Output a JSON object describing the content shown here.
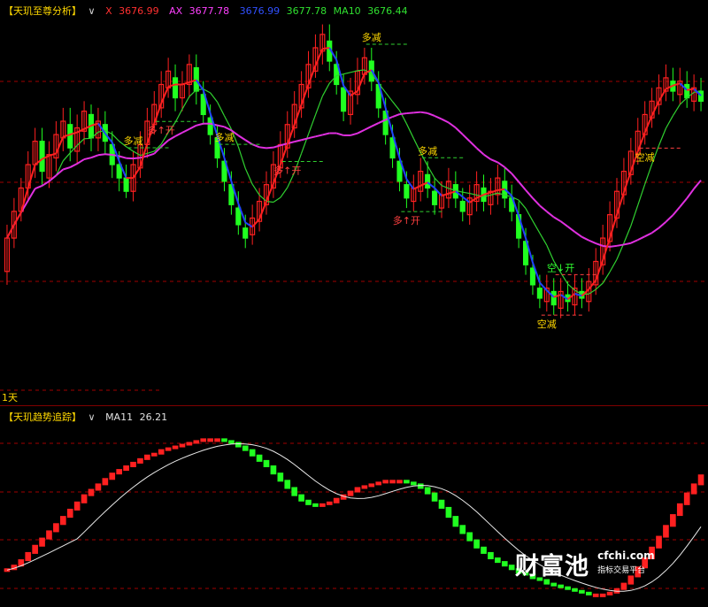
{
  "main_header": {
    "title": "【天玑至尊分析】",
    "chevron": "∨",
    "x": {
      "label": "X",
      "value": "3676.99",
      "color": "#ff3030"
    },
    "ax": {
      "label": "AX",
      "value": "3677.78",
      "color": "#ff40ff"
    },
    "v3": {
      "value": "3676.99",
      "color": "#3050ff"
    },
    "v4": {
      "value": "3677.78",
      "color": "#30e030"
    },
    "ma10": {
      "label": "MA10",
      "value": "3676.44",
      "color": "#30e030"
    }
  },
  "sub_header": {
    "title": "【天玑趋势追踪】",
    "chevron": "∨",
    "ma": {
      "label": "MA11",
      "value": "26.21",
      "color": "#e0e0e0"
    }
  },
  "period_label": "1天",
  "watermark": {
    "cn": "财富池",
    "domain": "cfchi.com",
    "sub": "指标交易平台"
  },
  "colors": {
    "up": "#ff2020",
    "down": "#20ff20",
    "fast_up": "#ff2020",
    "fast_down": "#2040ff",
    "slow": "#30d030",
    "long": "#e030e0",
    "signal": "#ffd800",
    "grid": "#a00000"
  },
  "chart_data": [
    {
      "type": "candlestick",
      "title": "【天玑至尊分析】",
      "ylim": [
        0,
        100
      ],
      "candles": [
        [
          30,
          40,
          26,
          44
        ],
        [
          40,
          48,
          37,
          52
        ],
        [
          48,
          55,
          45,
          58
        ],
        [
          55,
          62,
          51,
          66
        ],
        [
          62,
          69,
          58,
          73
        ],
        [
          69,
          60,
          56,
          73
        ],
        [
          58,
          65,
          55,
          69
        ],
        [
          64,
          71,
          60,
          75
        ],
        [
          70,
          75,
          66,
          79
        ],
        [
          74,
          67,
          63,
          79
        ],
        [
          66,
          73,
          62,
          77
        ],
        [
          72,
          78,
          68,
          81
        ],
        [
          77,
          70,
          66,
          80
        ],
        [
          70,
          75,
          66,
          79
        ],
        [
          74,
          69,
          65,
          78
        ],
        [
          68,
          62,
          58,
          72
        ],
        [
          62,
          58,
          54,
          66
        ],
        [
          58,
          54,
          52,
          62
        ],
        [
          54,
          62,
          51,
          66
        ],
        [
          61,
          68,
          58,
          72
        ],
        [
          68,
          75,
          64,
          79
        ],
        [
          74,
          80,
          71,
          84
        ],
        [
          79,
          86,
          76,
          90
        ],
        [
          85,
          90,
          82,
          94
        ],
        [
          88,
          82,
          78,
          92
        ],
        [
          82,
          86,
          78,
          90
        ],
        [
          86,
          92,
          82,
          95
        ],
        [
          91,
          84,
          80,
          95
        ],
        [
          83,
          77,
          74,
          87
        ],
        [
          76,
          71,
          68,
          80
        ],
        [
          70,
          64,
          61,
          74
        ],
        [
          63,
          57,
          54,
          67
        ],
        [
          56,
          50,
          47,
          60
        ],
        [
          49,
          44,
          41,
          54
        ],
        [
          43,
          40,
          37,
          47
        ],
        [
          41,
          46,
          38,
          50
        ],
        [
          45,
          51,
          42,
          55
        ],
        [
          50,
          56,
          47,
          60
        ],
        [
          55,
          62,
          52,
          66
        ],
        [
          61,
          68,
          58,
          72
        ],
        [
          67,
          74,
          64,
          78
        ],
        [
          73,
          80,
          70,
          84
        ],
        [
          79,
          86,
          76,
          90
        ],
        [
          85,
          92,
          82,
          96
        ],
        [
          90,
          97,
          88,
          101
        ],
        [
          96,
          101,
          92,
          104
        ],
        [
          99,
          93,
          90,
          104
        ],
        [
          92,
          86,
          83,
          96
        ],
        [
          85,
          78,
          75,
          89
        ],
        [
          77,
          84,
          74,
          88
        ],
        [
          83,
          90,
          80,
          94
        ],
        [
          89,
          94,
          86,
          97
        ],
        [
          93,
          87,
          84,
          97
        ],
        [
          86,
          79,
          76,
          90
        ],
        [
          78,
          71,
          68,
          82
        ],
        [
          70,
          64,
          61,
          74
        ],
        [
          63,
          57,
          54,
          67
        ],
        [
          56,
          52,
          49,
          60
        ],
        [
          51,
          55,
          48,
          59
        ],
        [
          54,
          60,
          51,
          64
        ],
        [
          59,
          55,
          52,
          63
        ],
        [
          54,
          50,
          47,
          58
        ],
        [
          49,
          53,
          46,
          57
        ],
        [
          52,
          57,
          49,
          61
        ],
        [
          56,
          52,
          49,
          60
        ],
        [
          51,
          48,
          45,
          55
        ],
        [
          47,
          52,
          44,
          56
        ],
        [
          51,
          56,
          48,
          60
        ],
        [
          55,
          51,
          48,
          59
        ],
        [
          50,
          54,
          47,
          58
        ],
        [
          53,
          58,
          50,
          62
        ],
        [
          57,
          52,
          49,
          61
        ],
        [
          52,
          48,
          45,
          56
        ],
        [
          47,
          40,
          37,
          51
        ],
        [
          39,
          32,
          29,
          43
        ],
        [
          31,
          26,
          23,
          35
        ],
        [
          25,
          22,
          19,
          29
        ],
        [
          21,
          25,
          18,
          29
        ],
        [
          24,
          20,
          17,
          28
        ],
        [
          19,
          24,
          16,
          28
        ],
        [
          23,
          21,
          18,
          27
        ],
        [
          20,
          25,
          17,
          29
        ],
        [
          24,
          22,
          19,
          28
        ],
        [
          21,
          27,
          18,
          31
        ],
        [
          26,
          33,
          23,
          37
        ],
        [
          32,
          40,
          29,
          44
        ],
        [
          39,
          47,
          36,
          51
        ],
        [
          46,
          54,
          43,
          58
        ],
        [
          53,
          60,
          50,
          64
        ],
        [
          59,
          66,
          56,
          70
        ],
        [
          65,
          72,
          62,
          76
        ],
        [
          71,
          77,
          68,
          81
        ],
        [
          76,
          81,
          73,
          85
        ],
        [
          80,
          85,
          77,
          89
        ],
        [
          84,
          88,
          81,
          92
        ],
        [
          87,
          84,
          81,
          91
        ],
        [
          83,
          87,
          80,
          91
        ],
        [
          86,
          82,
          79,
          90
        ],
        [
          81,
          85,
          78,
          89
        ],
        [
          84,
          81,
          78,
          88
        ]
      ],
      "fast_line": "X",
      "slow_line": "MA10",
      "long_line": "AX",
      "annotations": [
        {
          "text": "多减",
          "index": 18
        },
        {
          "text": "多减",
          "index": 31
        },
        {
          "text": "多减",
          "index": 52
        },
        {
          "text": "多减",
          "index": 60
        },
        {
          "text": "多↑开",
          "index": 57
        },
        {
          "text": "多↑开",
          "index": 40
        },
        {
          "text": "多↑开",
          "index": 22
        },
        {
          "text": "空↓开",
          "index": 79
        },
        {
          "text": "空减",
          "index": 77
        },
        {
          "text": "空减",
          "index": 91
        }
      ]
    },
    {
      "type": "bar",
      "title": "【天玑趋势追踪】",
      "ylim": [
        0,
        100
      ],
      "values": [
        18,
        20,
        23,
        27,
        31,
        35,
        39,
        43,
        47,
        51,
        55,
        59,
        62,
        65,
        68,
        71,
        73,
        75,
        77,
        79,
        81,
        82,
        84,
        85,
        86,
        87,
        88,
        89,
        90,
        90,
        90,
        89,
        88,
        86,
        84,
        81,
        78,
        75,
        71,
        67,
        63,
        59,
        56,
        54,
        53,
        54,
        55,
        57,
        59,
        61,
        63,
        64,
        65,
        66,
        67,
        67,
        67,
        66,
        65,
        63,
        60,
        56,
        52,
        47,
        42,
        38,
        34,
        30,
        27,
        24,
        22,
        20,
        18,
        16,
        15,
        13,
        12,
        10,
        9,
        8,
        7,
        6,
        5,
        4,
        4,
        4,
        5,
        7,
        10,
        14,
        19,
        24,
        30,
        36,
        42,
        48,
        54,
        60,
        65,
        70
      ],
      "ma_line": "MA11"
    }
  ]
}
